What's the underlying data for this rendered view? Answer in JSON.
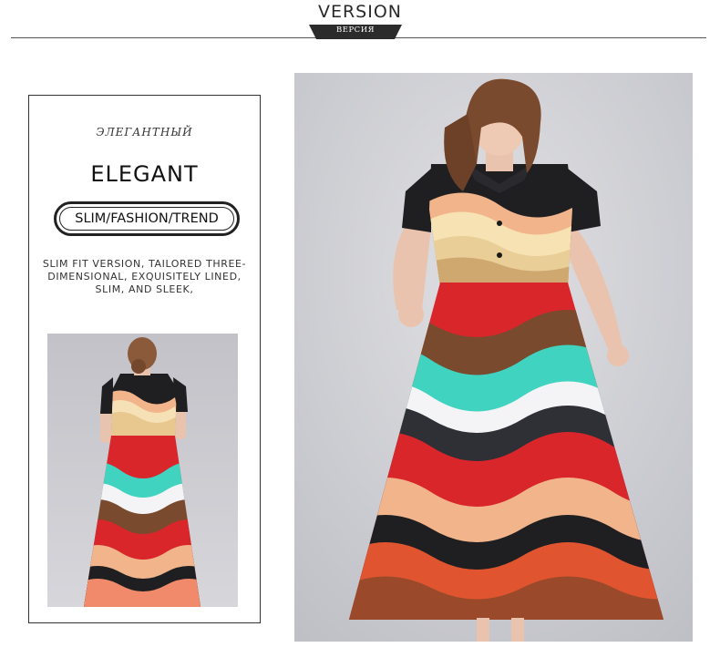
{
  "header": {
    "title": "VERSION",
    "tab_label": "ВЕРСИЯ"
  },
  "card": {
    "subtitle_ru": "ЭЛЕГАНТНЫЙ",
    "title": "ELEGANT",
    "pill_label": "SLIM/FASHION/TREND",
    "description_lines": [
      "SLIM FIT VERSION, TAILORED THREE-",
      "DIMENSIONAL, EXQUISITELY LINED,",
      "SLIM, AND SLEEK,"
    ]
  },
  "colors": {
    "line": "#555555",
    "tab": "#2b2b2b",
    "photo_bg": "#c9c9cf",
    "accent_red": "#d8262b",
    "accent_teal": "#3fd3c0",
    "accent_peach": "#f2b48a",
    "shirt_black": "#1f1f22"
  }
}
